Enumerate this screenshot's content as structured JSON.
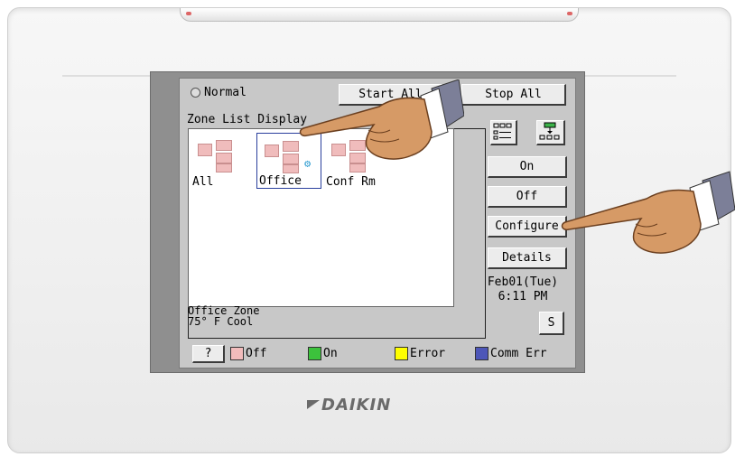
{
  "radio": {
    "label": "Normal"
  },
  "buttons": {
    "start_all": "Start All",
    "stop_all": "Stop All",
    "on": "On",
    "off": "Off",
    "configure": "Configure",
    "details": "Details",
    "s": "S",
    "help": "?"
  },
  "zone_list": {
    "title": "Zone List Display",
    "items": [
      {
        "label": "All"
      },
      {
        "label": "Office"
      },
      {
        "label": "Conf Rm"
      }
    ]
  },
  "status": {
    "zone_name": "Office Zone",
    "temp_mode": "75° F  Cool"
  },
  "clock": {
    "date": "Feb01(Tue)",
    "time": "6:11 PM"
  },
  "legend": [
    {
      "label": "Off",
      "color": "#f2bcbc"
    },
    {
      "label": "On",
      "color": "#3cc23c"
    },
    {
      "label": "Error",
      "color": "#ffff00"
    },
    {
      "label": "Comm Err",
      "color": "#4d56b8"
    }
  ],
  "brand": "DAIKIN",
  "icons": {
    "list_view": "list-view-icon",
    "tree_view": "tree-view-icon",
    "hand": "pointing-hand-icon"
  }
}
